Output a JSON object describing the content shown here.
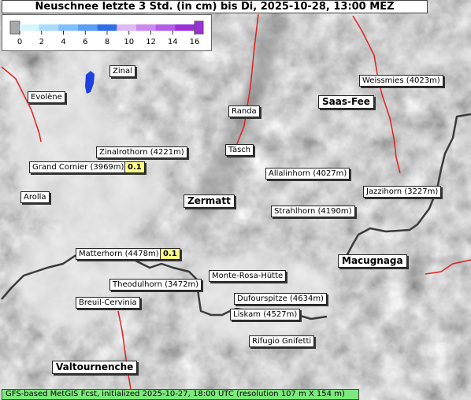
{
  "title": "Neuschnee letzte 3 Std. (in cm) bis Di, 2025-10-28, 13:00 MEZ",
  "legend": {
    "ticks": [
      "0",
      "2",
      "4",
      "6",
      "8",
      "10",
      "12",
      "14",
      "16"
    ],
    "colors": [
      "#d7f5ff",
      "#a8dcff",
      "#7fbfff",
      "#5a9ff5",
      "#2d6fe6",
      "#e1b8f3",
      "#cc88ef",
      "#b45be6",
      "#9b2fd9"
    ]
  },
  "places": [
    {
      "name": "Zinal",
      "big": false
    },
    {
      "name": "Evolène",
      "big": false
    },
    {
      "name": "Weissmies (4023m)",
      "big": false
    },
    {
      "name": "Saas-Fee",
      "big": true
    },
    {
      "name": "Randa",
      "big": false
    },
    {
      "name": "Täsch",
      "big": false
    },
    {
      "name": "Zinalrothorn (4221m)",
      "big": false
    },
    {
      "name": "Grand Cornier (3969m)",
      "big": false
    },
    {
      "name": "Allalinhorn (4027m)",
      "big": false
    },
    {
      "name": "Jazzihorn (3227m)",
      "big": false
    },
    {
      "name": "Arolla",
      "big": false
    },
    {
      "name": "Zermatt",
      "big": true
    },
    {
      "name": "Strahlhorn (4190m)",
      "big": false
    },
    {
      "name": "Matterhorn (4478m)",
      "big": false
    },
    {
      "name": "Macugnaga",
      "big": true
    },
    {
      "name": "Monte-Rosa-Hütte",
      "big": false
    },
    {
      "name": "Theodulhorn (3472m)",
      "big": false
    },
    {
      "name": "Dufourspitze (4634m)",
      "big": false
    },
    {
      "name": "Breuil-Cervinia",
      "big": false
    },
    {
      "name": "Liskam (4527m)",
      "big": false
    },
    {
      "name": "Rifugio Gnifetti",
      "big": false
    },
    {
      "name": "Valtournenche",
      "big": true
    }
  ],
  "values": [
    {
      "place": "Grand Cornier (3969m)",
      "value": "0.1"
    },
    {
      "place": "Matterhorn (4478m)",
      "value": "0.1"
    }
  ],
  "footer": "GFS-based MetGIS Fcst, initialized 2025-10-27, 18:00 UTC  (resolution 107 m X 154 m)",
  "colors": {
    "border_country": "#e02020",
    "border_region": "#3a3a3a",
    "footer_bg": "#7ee87e",
    "value_bg": "#ffff88",
    "snow_blue": "#1f3fe0"
  }
}
